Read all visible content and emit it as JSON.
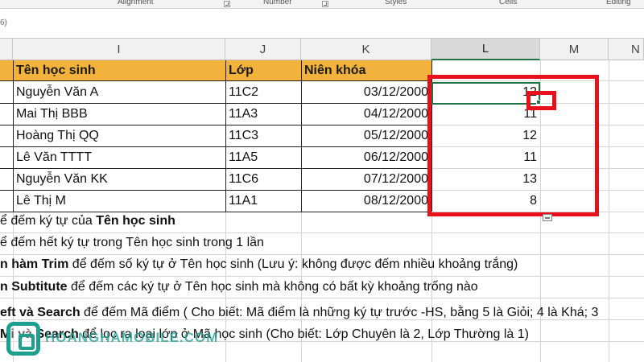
{
  "ribbon": {
    "groups": [
      "Alignment",
      "Number",
      "Styles",
      "Cells",
      "Editing"
    ]
  },
  "formula_bar": {
    "fragment": "6)"
  },
  "columns": [
    "I",
    "J",
    "K",
    "L",
    "M",
    "N"
  ],
  "selected_column": "L",
  "table": {
    "headers": [
      "Tên học sinh",
      "Lớp",
      "Niên khóa"
    ],
    "rows": [
      {
        "name": "Nguyễn Văn A",
        "class": "11C2",
        "year": "03/12/2000",
        "count": "12"
      },
      {
        "name": "Mai Thị BBB",
        "class": "11A3",
        "year": "04/12/2000",
        "count": "11"
      },
      {
        "name": "Hoàng Thị QQ",
        "class": "11C3",
        "year": "05/12/2000",
        "count": "12"
      },
      {
        "name": "Lê Văn TTTT",
        "class": "11A5",
        "year": "06/12/2000",
        "count": "11"
      },
      {
        "name": "Nguyễn Văn KK",
        "class": "11C6",
        "year": "07/12/2000",
        "count": "13"
      },
      {
        "name": "Lê Thị M",
        "class": "11A1",
        "year": "08/12/2000",
        "count": "8"
      }
    ]
  },
  "notes": [
    {
      "pre": "ể đếm ký tự của ",
      "bold": "Tên học sinh",
      "post": ""
    },
    {
      "pre": "ể đếm hết ký tự trong Tên học sinh trong 1 lần",
      "bold": "",
      "post": ""
    },
    {
      "pre": "",
      "bold": "n hàm Trim",
      "post": " để đếm số ký tự ở Tên học sinh (Lưu ý: không được đếm nhiều khoảng trắng)"
    },
    {
      "pre": "",
      "bold": "n Subtitute",
      "post": " để đếm các ký tự ở Tên học sinh mà không có bất kỳ khoảng trống nào"
    },
    {
      "pre": "",
      "bold": "eft và Search",
      "post": " để đếm Mã điểm ( Cho biết: Mã điểm là những ký tự trước -HS, bằng 5 là Giỏi; 4 là Khá; 3"
    },
    {
      "pre": "",
      "bold": "Mi và Search",
      "post": " để lọc ra loại lớp ở Mã học sinh (Cho biết: Lớp Chuyên là 2, Lớp Thường là 1)"
    }
  ],
  "watermark": {
    "text": "HOANGHAMOBILE.COM",
    "icon": "hoanghamobile-logo-icon"
  },
  "colors": {
    "header_fill": "#f2b23c",
    "highlight": "#e8101a",
    "selection": "#217346"
  }
}
